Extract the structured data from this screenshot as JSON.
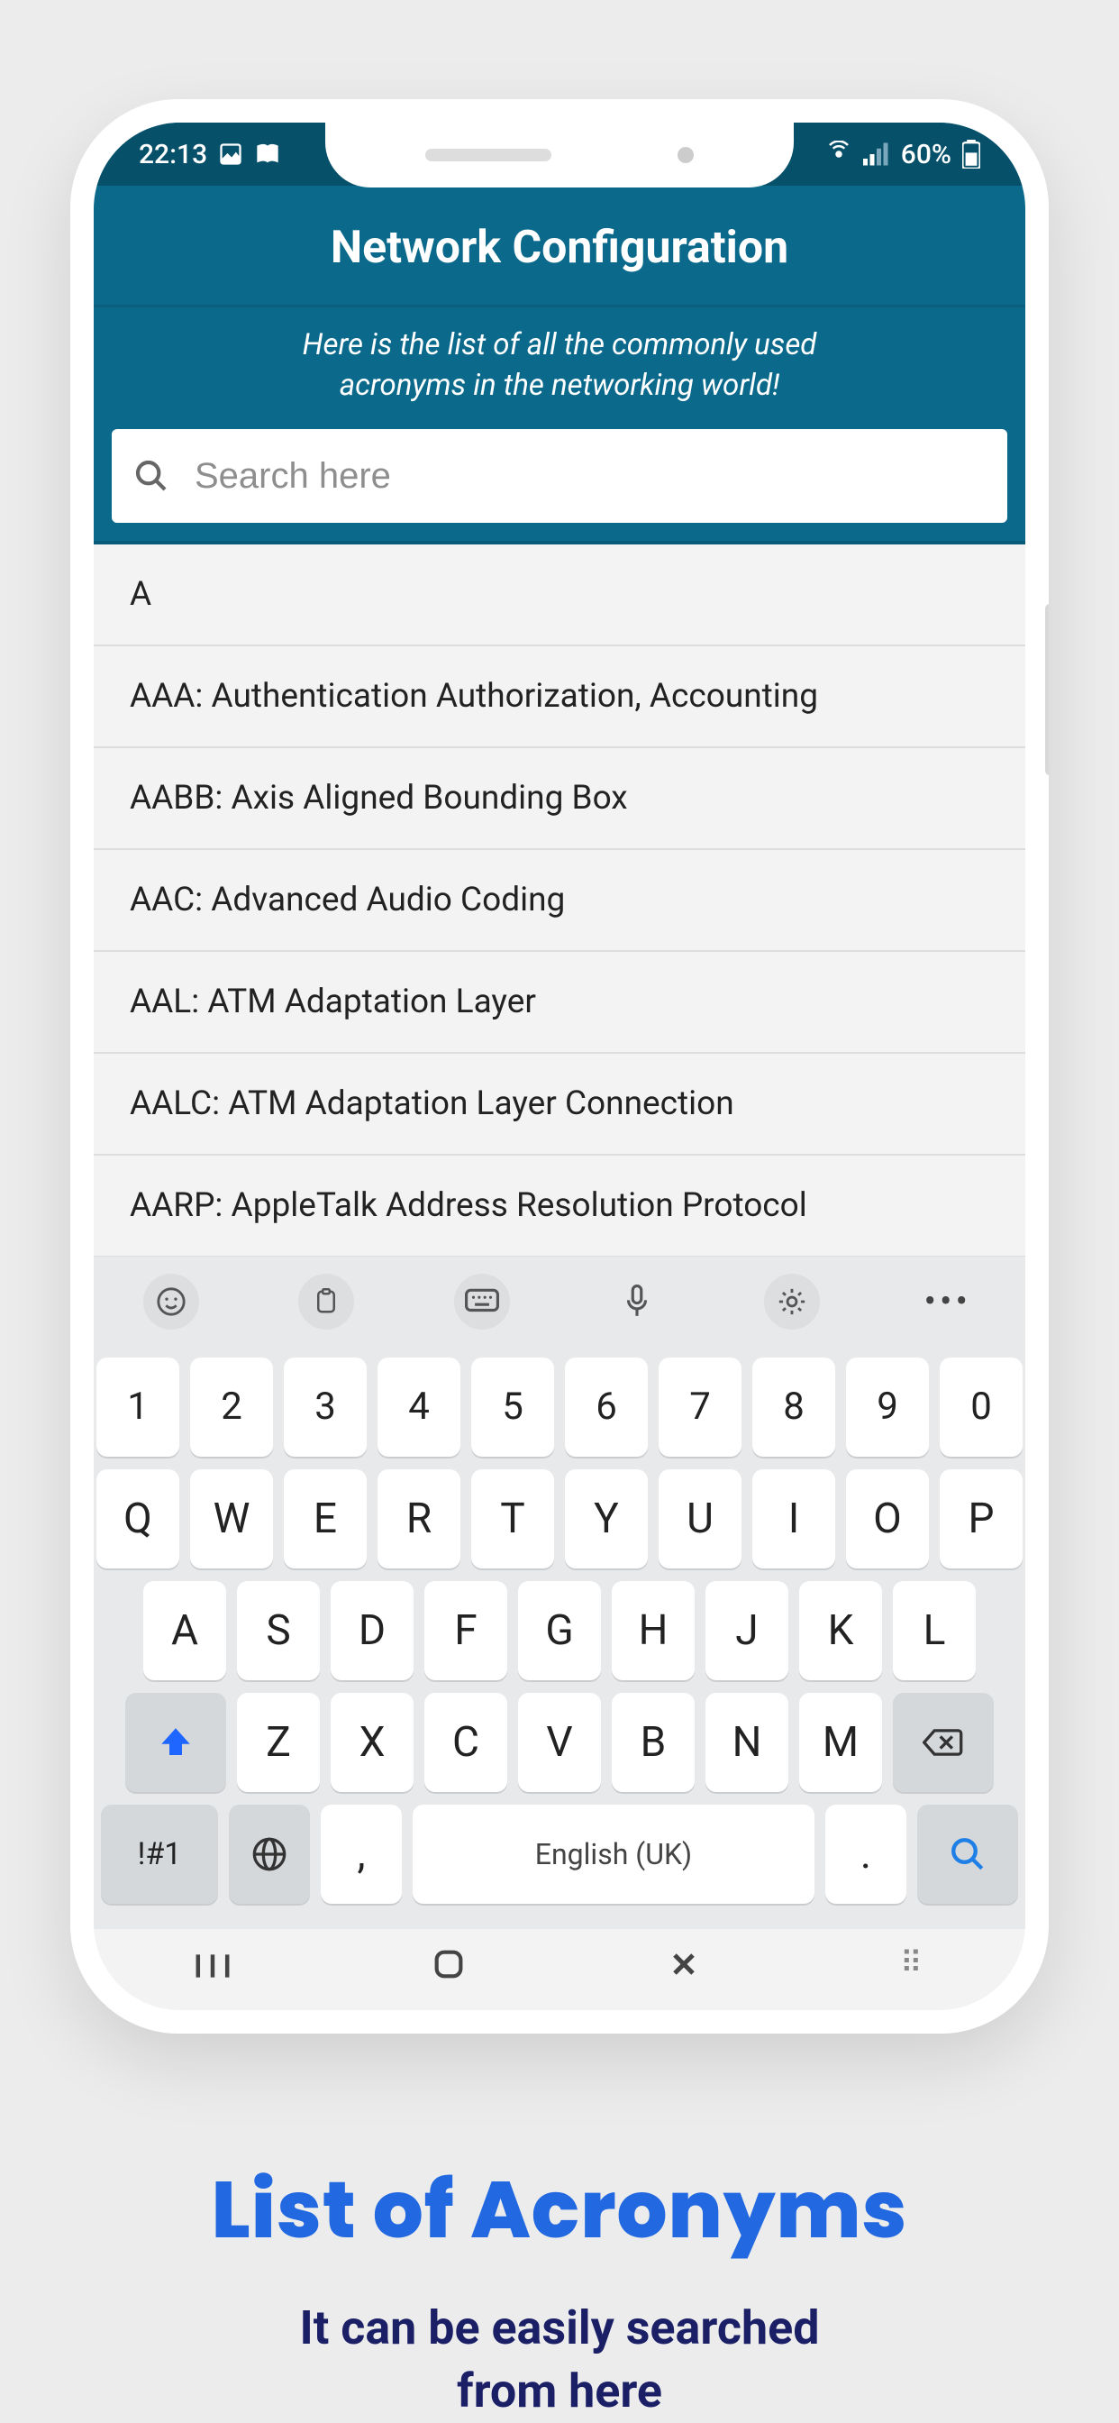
{
  "status": {
    "time": "22:13",
    "battery_text": "60%"
  },
  "header": {
    "title": "Network Configuration",
    "subtitle_line1": "Here is the list of all the commonly used",
    "subtitle_line2": "acronyms in the networking world!"
  },
  "search": {
    "placeholder": "Search here",
    "value": ""
  },
  "list": {
    "items": [
      {
        "text": "A",
        "section": true
      },
      {
        "text": "AAA: Authentication Authorization, Accounting"
      },
      {
        "text": "AABB: Axis Aligned Bounding Box"
      },
      {
        "text": "AAC: Advanced Audio Coding"
      },
      {
        "text": "AAL: ATM Adaptation Layer"
      },
      {
        "text": "AALC: ATM Adaptation Layer Connection"
      },
      {
        "text": "AARP: AppleTalk Address Resolution Protocol"
      }
    ]
  },
  "keyboard": {
    "row_num": [
      "1",
      "2",
      "3",
      "4",
      "5",
      "6",
      "7",
      "8",
      "9",
      "0"
    ],
    "row1": [
      "Q",
      "W",
      "E",
      "R",
      "T",
      "Y",
      "U",
      "I",
      "O",
      "P"
    ],
    "row2": [
      "A",
      "S",
      "D",
      "F",
      "G",
      "H",
      "J",
      "K",
      "L"
    ],
    "row3": [
      "Z",
      "X",
      "C",
      "V",
      "B",
      "N",
      "M"
    ],
    "sym_label": "!#1",
    "space_label": "English (UK)",
    "comma": ",",
    "period": "."
  },
  "marketing": {
    "title": "List of Acronyms",
    "sub_line1": "It can be easily searched",
    "sub_line2": "from here"
  }
}
